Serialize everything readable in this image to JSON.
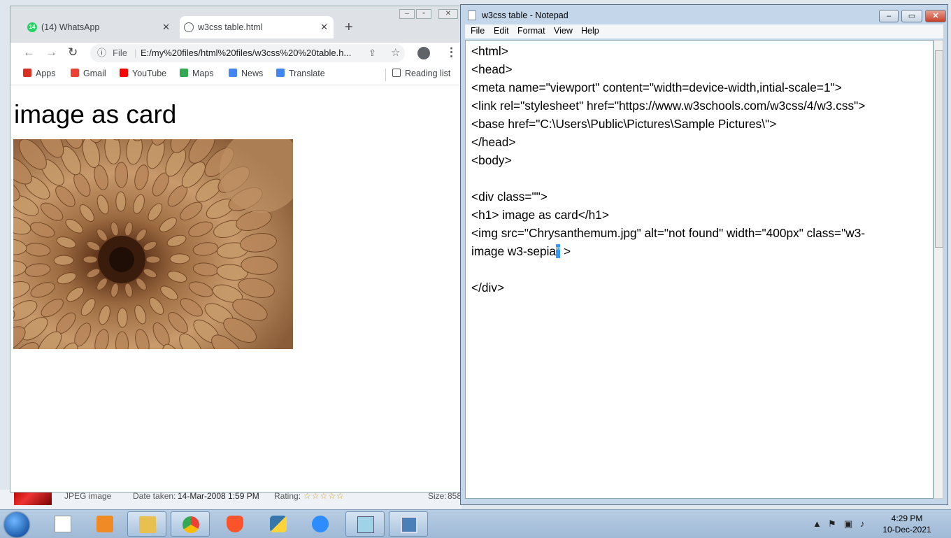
{
  "explorer_strip": {
    "file_type": "JPEG image",
    "date_taken_label": "Date taken:",
    "date_taken_value": "14-Mar-2008 1:59 PM",
    "rating_label": "Rating:",
    "rating_stars": "☆☆☆☆☆",
    "size_label": "Size:",
    "size_value": "858"
  },
  "chrome": {
    "tabs": [
      {
        "label": "(14) WhatsApp",
        "badge": "14",
        "icon": "whatsapp-icon"
      },
      {
        "label": "w3css  table.html",
        "icon": "globe-icon"
      }
    ],
    "tab_close": "✕",
    "new_tab": "+",
    "omnibox": {
      "info": "ⓘ",
      "scheme": "File",
      "url": "E:/my%20files/html%20files/w3css%20%20table.h..."
    },
    "bookmarks": [
      {
        "label": "Apps",
        "icon": "apps-grid-icon",
        "color": "#d93025"
      },
      {
        "label": "Gmail",
        "icon": "gmail-icon",
        "color": "#ea4335"
      },
      {
        "label": "YouTube",
        "icon": "youtube-icon",
        "color": "#ff0000"
      },
      {
        "label": "Maps",
        "icon": "maps-icon",
        "color": "#34a853"
      },
      {
        "label": "News",
        "icon": "news-icon",
        "color": "#4285f4"
      },
      {
        "label": "Translate",
        "icon": "translate-icon",
        "color": "#4285f4"
      }
    ],
    "reading_list": "Reading list",
    "page": {
      "heading": "image as card"
    }
  },
  "notepad": {
    "title": "w3css  table - Notepad",
    "menu": [
      "File",
      "Edit",
      "Format",
      "View",
      "Help"
    ],
    "lines": [
      "<html>",
      "<head>",
      "<meta name=\"viewport\" content=\"width=device-width,intial-scale=1\">",
      "<link rel=\"stylesheet\" href=\"https://www.w3schools.com/w3css/4/w3.css\">",
      "<base href=\"C:\\Users\\Public\\Pictures\\Sample Pictures\\\">",
      "</head>",
      "<body>",
      "",
      "<div class=\"\">",
      "<h1> image as card</h1>",
      "<img src=\"Chrysanthemum.jpg\" alt=\"not found\" width=\"400px\" class=\"w3-",
      "image w3-sepia",
      "",
      "</div>"
    ],
    "selected_char": "\"",
    "line_tail": " >"
  },
  "taskbar": {
    "time": "4:29 PM",
    "date": "10-Dec-2021"
  }
}
